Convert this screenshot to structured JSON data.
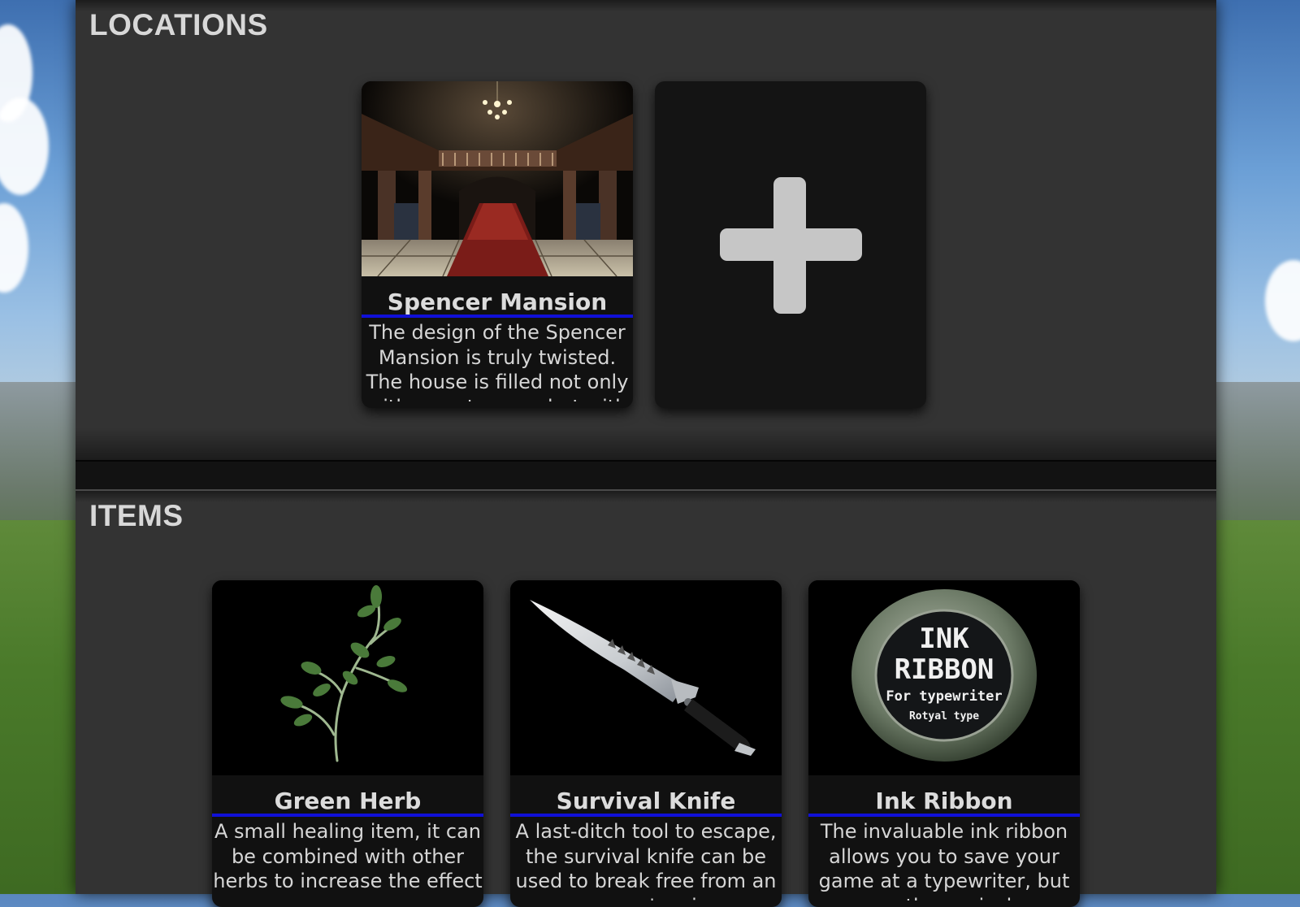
{
  "locations": {
    "title": "LOCATIONS",
    "cards": [
      {
        "name": "Spencer Mansion",
        "description": "The design of the Spencer Mansion is truly twisted. The house is filled not only with secret rooms but with traps and puzzles."
      }
    ],
    "add_card_icon": "plus-icon"
  },
  "items": {
    "title": "ITEMS",
    "cards": [
      {
        "name": "Green Herb",
        "description": "A small healing item, it can be combined with other herbs to increase the effect"
      },
      {
        "name": "Survival Knife",
        "description": "A last-ditch tool to escape, the survival knife can be used to break free from an enemy's grip"
      },
      {
        "name": "Ink Ribbon",
        "description": "The invaluable ink ribbon allows you to save your game at a typewriter, but use them wisely",
        "image_text": [
          "INK",
          "RIBBON",
          "For typewriter",
          "Rotyal type"
        ]
      }
    ]
  },
  "colors": {
    "accent_underline": "#1010d8",
    "card_bg": "#111111",
    "section_bg": "#333333"
  }
}
